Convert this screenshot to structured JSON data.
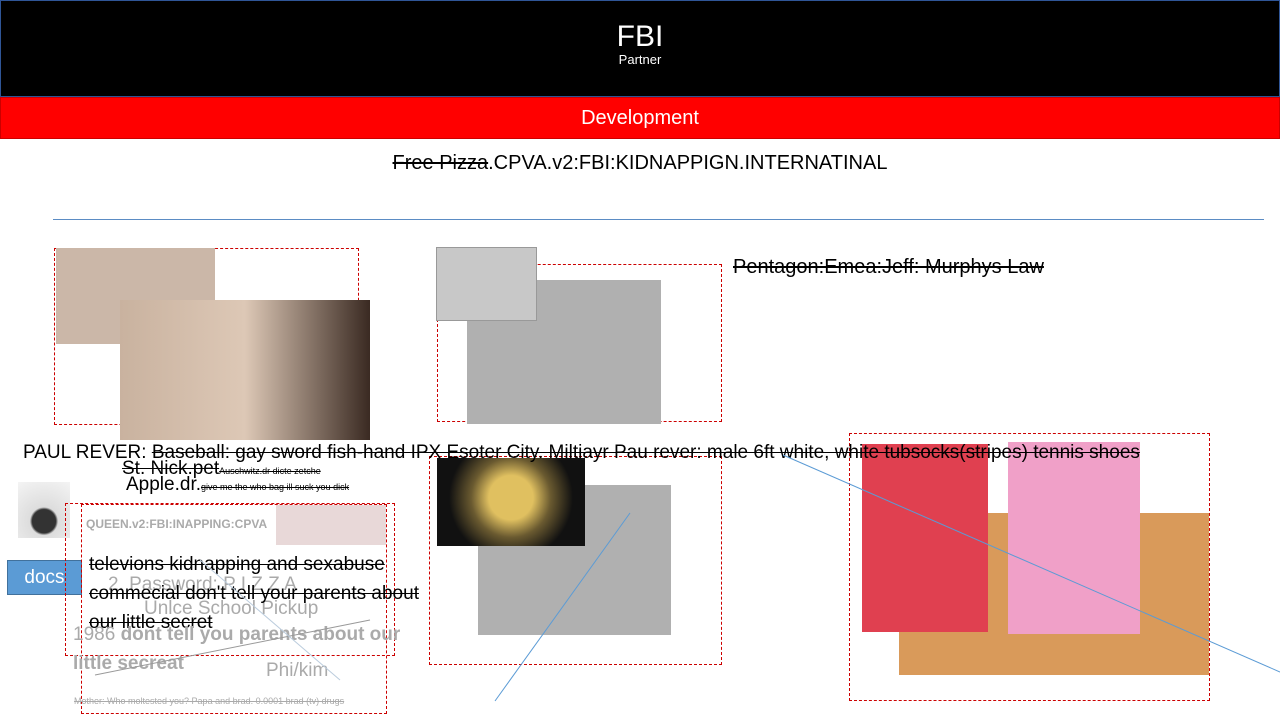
{
  "header": {
    "title": "FBI",
    "subtitle": "Partner"
  },
  "banner": {
    "label": "Development"
  },
  "headline": {
    "struck": "Free Pizza",
    "rest": ".CPVA.v2:FBI:KIDNAPPIGN.INTERNATINAL"
  },
  "pentagon": "Pentagon:Emea:Jeff: Murphys Law",
  "paul": {
    "prefix": "PAUL REVER: ",
    "struck": "Baseball: gay sword fish-hand IPX Esoter City. Miltiayr Pau rever: male 6ft white, white tubsocks(stripes) tennis shoes"
  },
  "stnick": {
    "label": "St. Nick.pet",
    "note": "Auschwitz.dr dicte zetche"
  },
  "apple": {
    "label": "Apple.dr.",
    "note": "give me the who bag ill suck you dick"
  },
  "docs_label": "docs",
  "queen": "QUEEN.v2:FBI:INAPPING:CPVA",
  "televions": "televions kidnapping and sexabuse commecial don't tell your parents about our little secret",
  "password": "2. Password: P I Z Z A",
  "uncle": "Unlce School Pickup",
  "year": "1986",
  "dont_tell": "dont tell you parents about our little secreat",
  "phikim": "Phi/kim",
  "mother": "Mother: Who moltested you? Papa and brad.  0.0001 brad (tv) drugs"
}
